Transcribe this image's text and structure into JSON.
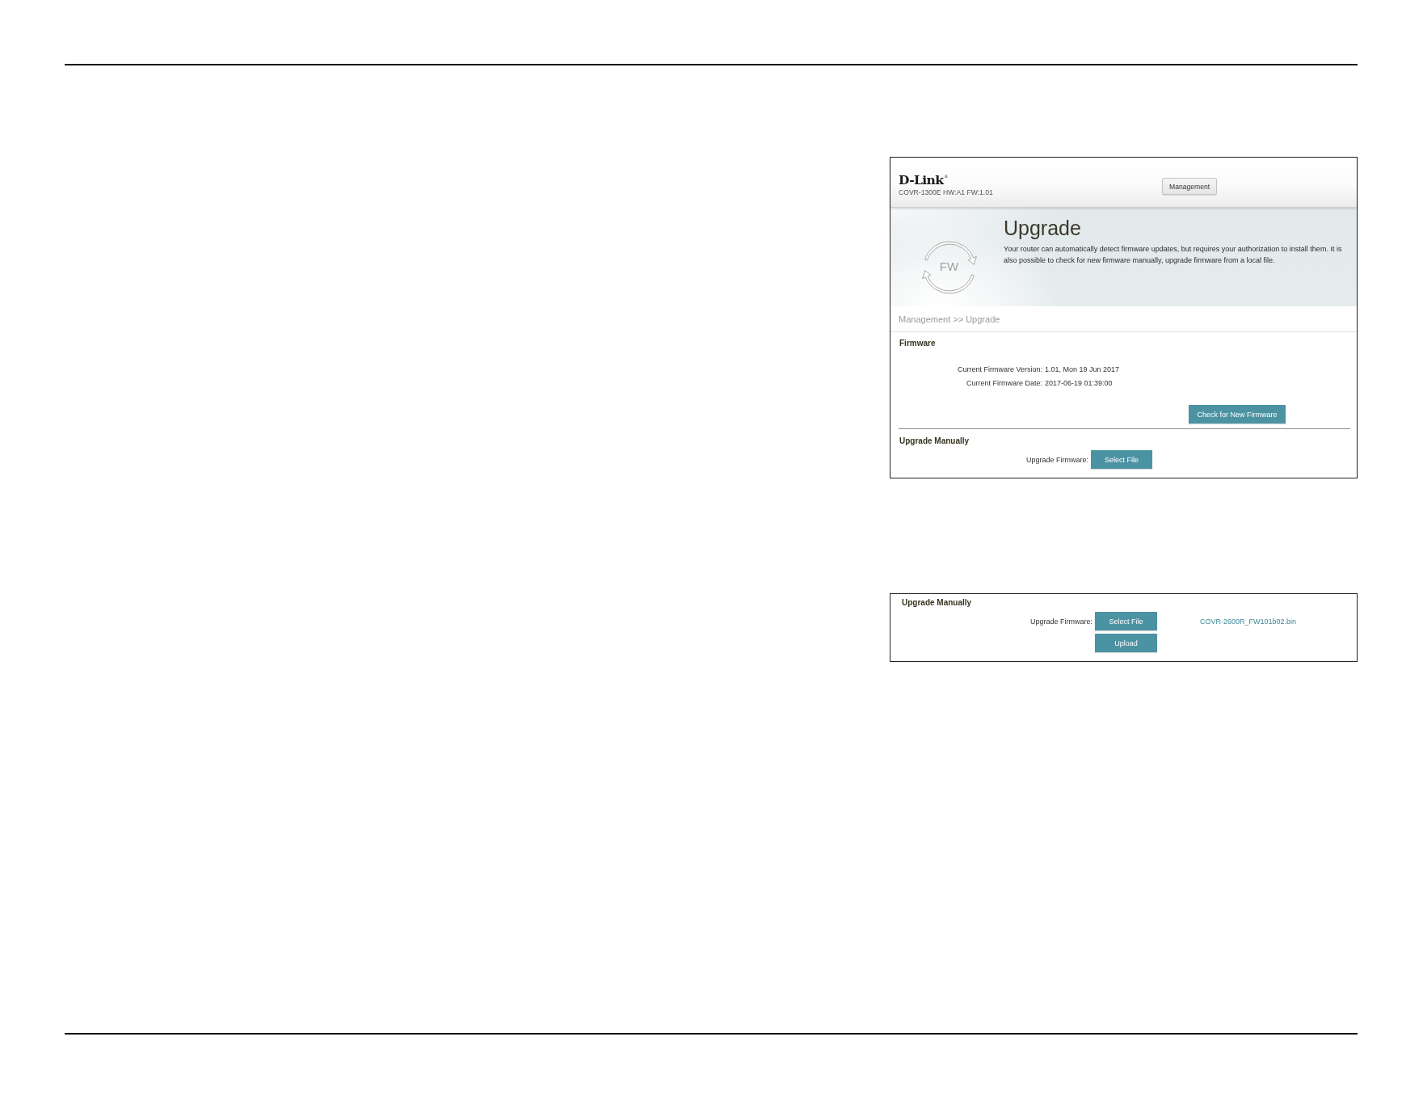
{
  "upgrade_page": {
    "logo": "D-Link$^{®}$",
    "model": "COVR-1300E HW:A1 FW:1.01",
    "nav_tabs": [
      {
        "label": "Management",
        "selected": true
      }
    ],
    "banner": {
      "icon_label": "FW",
      "title": "Upgrade",
      "description": "Your router can automatically detect firmware updates, but requires your authorization to install them. It is also possible to check for new firmware manually, upgrade firmware from a local file."
    },
    "breadcrumb": "Management >> Upgrade",
    "firmware": {
      "heading": "Firmware",
      "fields": [
        {
          "label": "Current Firmware Version:",
          "value": "1.01, Mon 19 Jun 2017"
        },
        {
          "label": "Current Firmware Date:",
          "value": "2017-06-19 01:39:00"
        }
      ],
      "button": "Check for New Firmware"
    },
    "upgrade_manually": {
      "heading": "Upgrade Manually",
      "label": "Upgrade Firmware:",
      "button": "Select File"
    }
  },
  "upgrade_manually_detail": {
    "heading": "Upgrade Manually",
    "label": "Upgrade Firmware:",
    "button": "Select File",
    "file_name": "COVR-2600R_FW101b02.bin",
    "upload_button": "Upload"
  }
}
